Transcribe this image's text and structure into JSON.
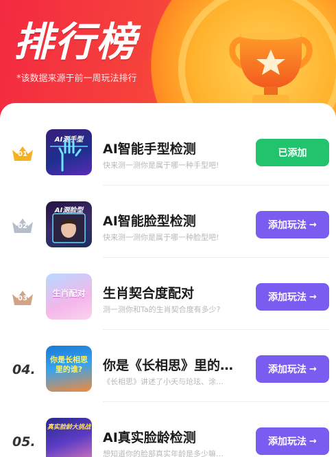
{
  "header": {
    "title": "排行榜",
    "subtitle": "*该数据来源于前一周玩法排行"
  },
  "colors": {
    "banner_red": "#f32a41",
    "banner_orange": "#ffa62a",
    "added_green": "#22c36d",
    "add_purple": "#7a5cf0",
    "crown_gold": "#f5b21f",
    "crown_silver": "#b8bec9",
    "crown_bronze": "#d2a387"
  },
  "items": [
    {
      "rank": "01",
      "rank_style": "crown-gold",
      "thumb_label": "AI测手型",
      "title": "AI智能手型检测",
      "desc": "快来测一测你是属于哪一种手型吧!",
      "button": "已添加",
      "button_state": "added"
    },
    {
      "rank": "02",
      "rank_style": "crown-silver",
      "thumb_label": "AI测脸型",
      "title": "AI智能脸型检测",
      "desc": "快来测一测你是属于哪一种脸型吧!",
      "button": "添加玩法",
      "button_state": "add"
    },
    {
      "rank": "03",
      "rank_style": "crown-bronze",
      "thumb_label": "生肖配对",
      "title": "生肖契合度配对",
      "desc": "测一测你和Ta的生肖契合度有多少?",
      "button": "添加玩法",
      "button_state": "add"
    },
    {
      "rank": "04.",
      "rank_style": "text",
      "thumb_label": "你是长相思里的谁?",
      "title": "你是《长相思》里的…",
      "desc": "《长相思》讲述了小夭与玱玹、涂…",
      "button": "添加玩法",
      "button_state": "add"
    },
    {
      "rank": "05.",
      "rank_style": "text",
      "thumb_label": "真实脸龄大挑战",
      "title": "AI真实脸龄检测",
      "desc": "想知道你的脸部真实年龄是多少嘛…",
      "button": "添加玩法",
      "button_state": "add"
    }
  ],
  "icons": {
    "trophy": "trophy-icon",
    "crown": "crown-icon",
    "arrow": "chevron-right-icon",
    "clock": "alarm-clock-icon"
  }
}
